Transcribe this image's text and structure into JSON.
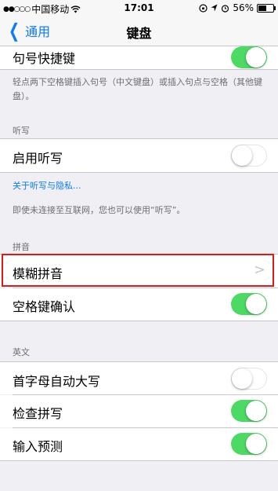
{
  "status": {
    "signal_dots": "●●○○○",
    "carrier": "中国移动",
    "wifi_icon": "wifi-icon",
    "time": "17:01",
    "battery_percent": "56%",
    "battery_level": 0.56
  },
  "nav": {
    "back_label": "通用",
    "title": "键盘"
  },
  "sections": {
    "period_shortcut": {
      "label": "句号快捷键",
      "on": true
    },
    "period_footer": "轻点两下空格键插入句号（中文键盘）或插入句点与空格（其他键盘）。",
    "dictation_header": "听写",
    "enable_dictation": {
      "label": "启用听写",
      "on": false
    },
    "dictation_link": "关于听写与隐私...",
    "dictation_footer": "即使未连接至互联网，您也可以使用“听写”。",
    "pinyin_header": "拼音",
    "fuzzy_pinyin": {
      "label": "模糊拼音"
    },
    "space_confirm": {
      "label": "空格键确认",
      "on": true
    },
    "english_header": "英文",
    "auto_capitalization": {
      "label": "首字母自动大写",
      "on": false
    },
    "check_spelling": {
      "label": "检查拼写",
      "on": true
    },
    "predictive": {
      "label": "输入预测",
      "on": true
    }
  },
  "colors": {
    "accent": "#0a7aff",
    "toggle_on": "#4cd964",
    "highlight": "#e01a1a"
  }
}
